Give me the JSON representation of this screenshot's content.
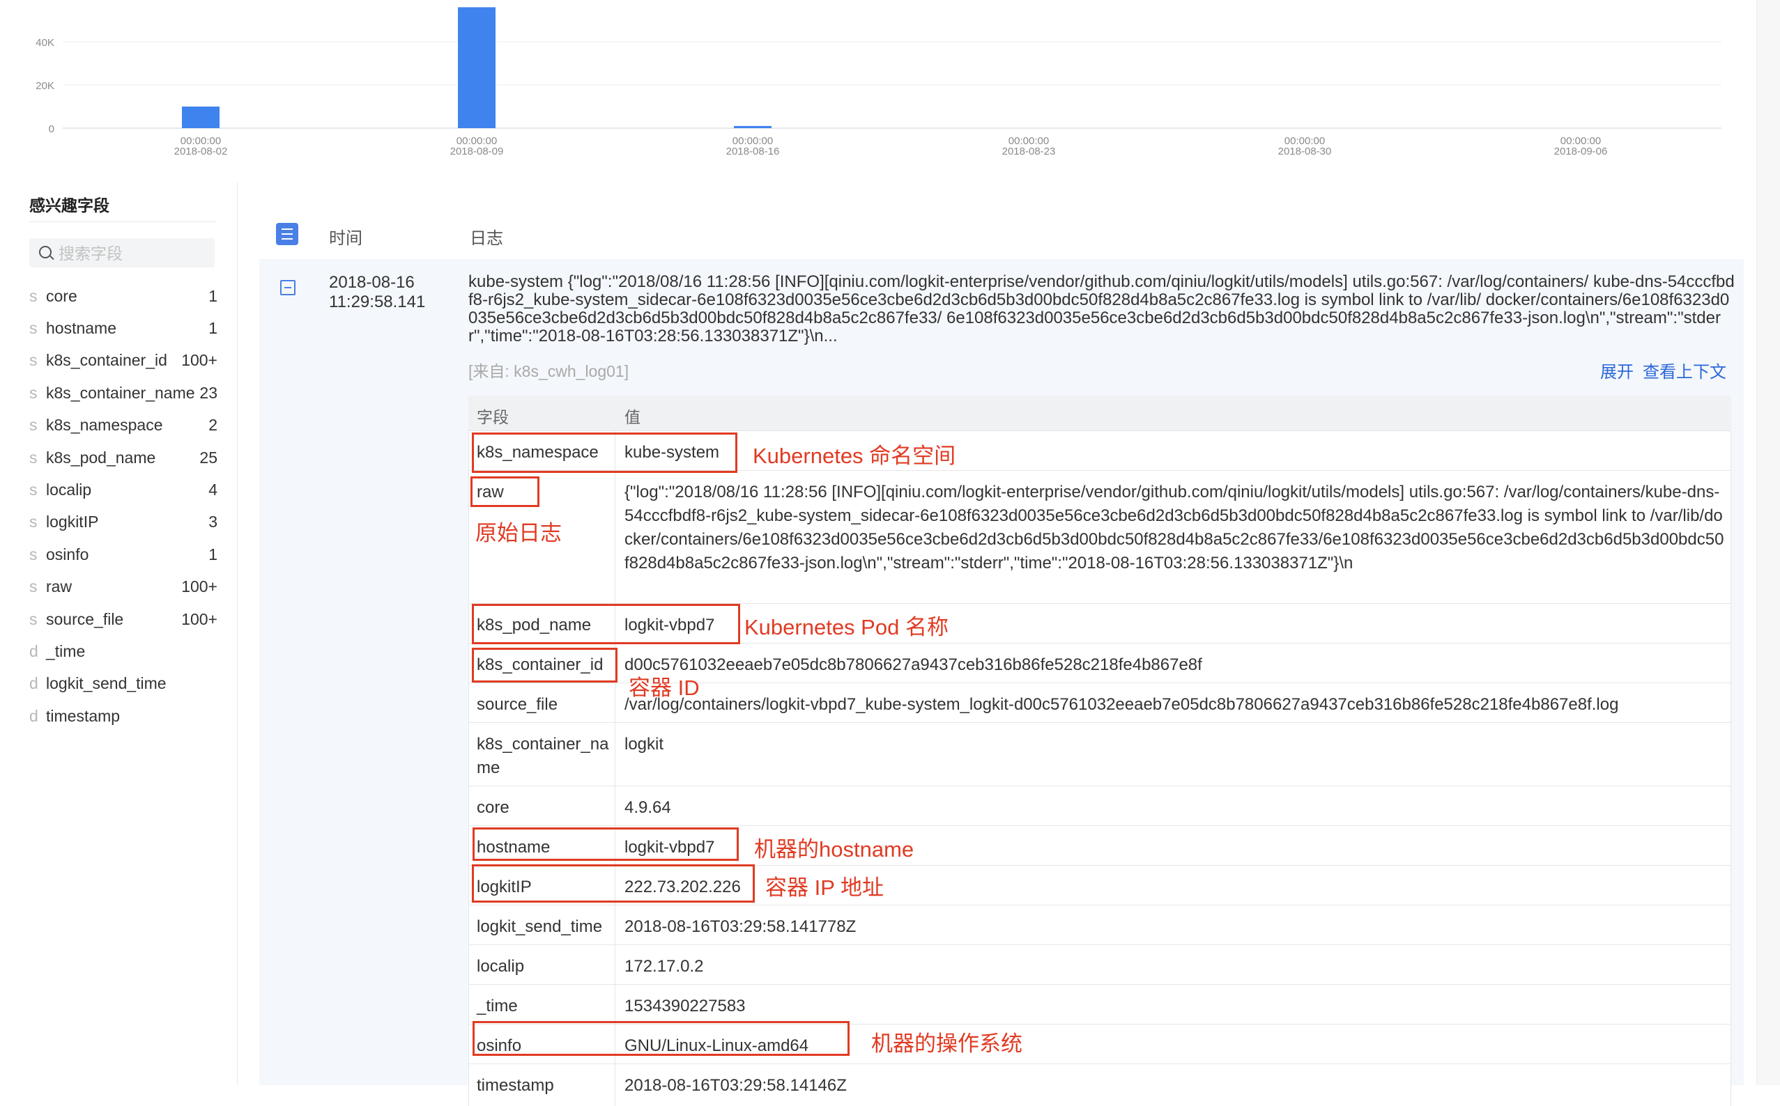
{
  "histogram": {
    "y_ticks": [
      "0",
      "20K",
      "40K"
    ],
    "x_ticks": [
      {
        "time": "00:00:00",
        "date": "2018-08-02"
      },
      {
        "time": "00:00:00",
        "date": "2018-08-09"
      },
      {
        "time": "00:00:00",
        "date": "2018-08-16"
      },
      {
        "time": "00:00:00",
        "date": "2018-08-23"
      },
      {
        "time": "00:00:00",
        "date": "2018-08-30"
      },
      {
        "time": "00:00:00",
        "date": "2018-09-06"
      }
    ],
    "bars": [
      {
        "date": "2018-08-02",
        "value": 10000
      },
      {
        "date": "2018-08-09",
        "value": 56000
      },
      {
        "date": "2018-08-16",
        "value": 1000
      }
    ],
    "ymax": 56000,
    "bar_color": "#3f83ee"
  },
  "sidebar": {
    "title": "感兴趣字段",
    "search_placeholder": "搜索字段",
    "fields": [
      {
        "type": "s",
        "name": "core",
        "count": "1"
      },
      {
        "type": "s",
        "name": "hostname",
        "count": "1"
      },
      {
        "type": "s",
        "name": "k8s_container_id",
        "count": "100+"
      },
      {
        "type": "s",
        "name": "k8s_container_name",
        "count": "23"
      },
      {
        "type": "s",
        "name": "k8s_namespace",
        "count": "2"
      },
      {
        "type": "s",
        "name": "k8s_pod_name",
        "count": "25"
      },
      {
        "type": "s",
        "name": "localip",
        "count": "4"
      },
      {
        "type": "s",
        "name": "logkitIP",
        "count": "3"
      },
      {
        "type": "s",
        "name": "osinfo",
        "count": "1"
      },
      {
        "type": "s",
        "name": "raw",
        "count": "100+"
      },
      {
        "type": "s",
        "name": "source_file",
        "count": "100+"
      },
      {
        "type": "d",
        "name": "_time",
        "count": ""
      },
      {
        "type": "d",
        "name": "logkit_send_time",
        "count": ""
      },
      {
        "type": "d",
        "name": "timestamp",
        "count": ""
      }
    ]
  },
  "main": {
    "col_time": "时间",
    "col_log": "日志",
    "entry": {
      "date": "2018-08-16",
      "time": "11:29:58.141",
      "text": "kube-system {\"log\":\"2018/08/16 11:28:56 [INFO][qiniu.com/logkit-enterprise/vendor/github.com/qiniu/logkit/utils/models] utils.go:567: /var/log/containers/ kube-dns-54cccfbdf8-r6js2_kube-system_sidecar-6e108f6323d0035e56ce3cbe6d2d3cb6d5b3d00bdc50f828d4b8a5c2c867fe33.log is symbol link to /var/lib/ docker/containers/6e108f6323d0035e56ce3cbe6d2d3cb6d5b3d00bdc50f828d4b8a5c2c867fe33/ 6e108f6323d0035e56ce3cbe6d2d3cb6d5b3d00bdc50f828d4b8a5c2c867fe33-json.log\\n\",\"stream\":\"stderr\",\"time\":\"2018-08-16T03:28:56.133038371Z\"}\\n...",
      "source": "[来自: k8s_cwh_log01]",
      "expand": "展开",
      "context": "查看上下文"
    },
    "table": {
      "header_field": "字段",
      "header_value": "值",
      "rows": [
        {
          "key": "k8s_namespace",
          "value": "kube-system"
        },
        {
          "key": "raw",
          "value": "{\"log\":\"2018/08/16 11:28:56 [INFO][qiniu.com/logkit-enterprise/vendor/github.com/qiniu/logkit/utils/models] utils.go:567: /var/log/containers/kube-dns-54cccfbdf8-r6js2_kube-system_sidecar-6e108f6323d0035e56ce3cbe6d2d3cb6d5b3d00bdc50f828d4b8a5c2c867fe33.log is symbol link to /var/lib/docker/containers/6e108f6323d0035e56ce3cbe6d2d3cb6d5b3d00bdc50f828d4b8a5c2c867fe33/6e108f6323d0035e56ce3cbe6d2d3cb6d5b3d00bdc50f828d4b8a5c2c867fe33-json.log\\n\",\"stream\":\"stderr\",\"time\":\"2018-08-16T03:28:56.133038371Z\"}\\n"
        },
        {
          "key": "k8s_pod_name",
          "value": "logkit-vbpd7"
        },
        {
          "key": "k8s_container_id",
          "value": "d00c5761032eeaeb7e05dc8b7806627a9437ceb316b86fe528c218fe4b867e8f"
        },
        {
          "key": "source_file",
          "value": "/var/log/containers/logkit-vbpd7_kube-system_logkit-d00c5761032eeaeb7e05dc8b7806627a9437ceb316b86fe528c218fe4b867e8f.log"
        },
        {
          "key": "k8s_container_name",
          "value": "logkit"
        },
        {
          "key": "core",
          "value": "4.9.64"
        },
        {
          "key": "hostname",
          "value": "logkit-vbpd7"
        },
        {
          "key": "logkitIP",
          "value": "222.73.202.226"
        },
        {
          "key": "logkit_send_time",
          "value": "2018-08-16T03:29:58.141778Z"
        },
        {
          "key": "localip",
          "value": "172.17.0.2"
        },
        {
          "key": "_time",
          "value": "1534390227583"
        },
        {
          "key": "osinfo",
          "value": "GNU/Linux-Linux-amd64"
        },
        {
          "key": "timestamp",
          "value": "2018-08-16T03:29:58.14146Z"
        }
      ]
    }
  },
  "annotations": {
    "namespace": "Kubernetes 命名空间",
    "raw": "原始日志",
    "pod": "Kubernetes Pod  名称",
    "container_id": "容器 ID",
    "hostname": "机器的hostname",
    "ip": "容器 IP 地址",
    "os": "机器的操作系统",
    "color": "#e03b23"
  }
}
